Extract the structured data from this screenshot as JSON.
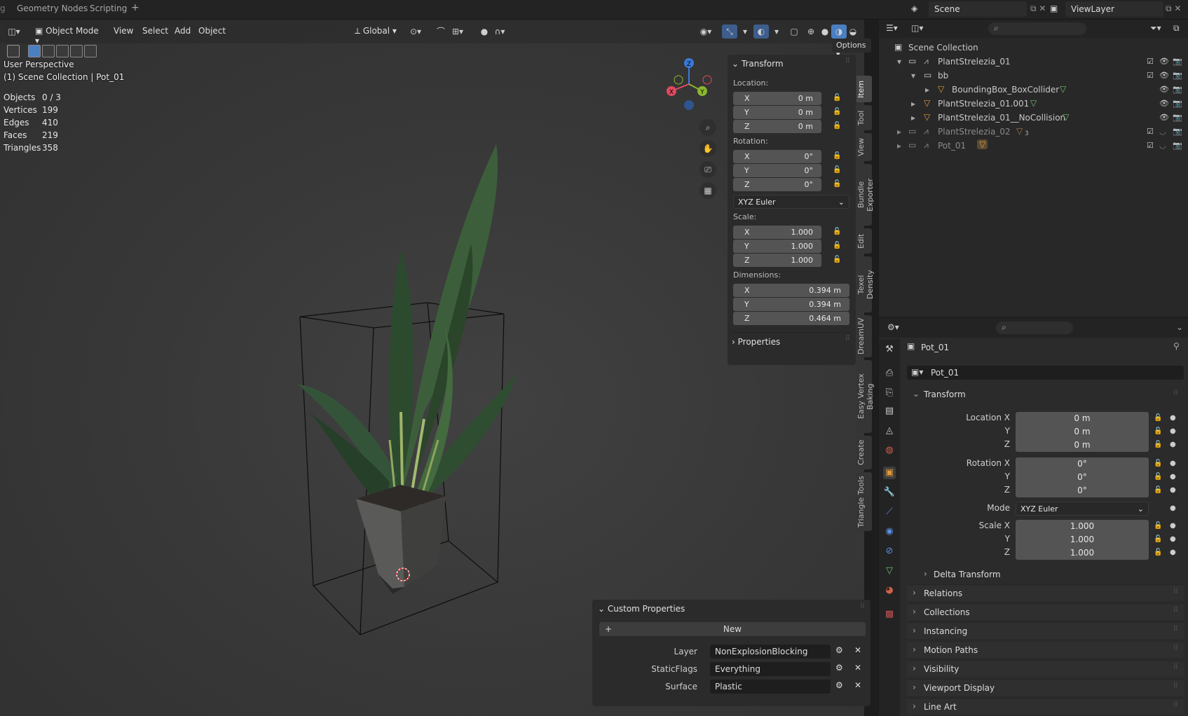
{
  "topbar": {
    "workspace_tabs": [
      "Geometry Nodes",
      "Scripting"
    ],
    "add_tab": "+",
    "scene": "Scene",
    "view_layer": "ViewLayer"
  },
  "viewport_header": {
    "mode": "Object Mode",
    "menus": [
      "View",
      "Select",
      "Add",
      "Object"
    ],
    "orientation": "Global",
    "options": "Options"
  },
  "overlay": {
    "view_name": "User Perspective",
    "collection_path": "(1) Scene Collection | Pot_01",
    "stats": [
      {
        "label": "Objects",
        "value": "0 / 3"
      },
      {
        "label": "Vertices",
        "value": "199"
      },
      {
        "label": "Edges",
        "value": "410"
      },
      {
        "label": "Faces",
        "value": "219"
      },
      {
        "label": "Triangles",
        "value": "358"
      }
    ]
  },
  "gizmo": {
    "x": "X",
    "y": "Y",
    "z": "Z"
  },
  "npanel": {
    "title": "Transform",
    "location_label": "Location:",
    "location": [
      {
        "axis": "X",
        "value": "0 m"
      },
      {
        "axis": "Y",
        "value": "0 m"
      },
      {
        "axis": "Z",
        "value": "0 m"
      }
    ],
    "rotation_label": "Rotation:",
    "rotation": [
      {
        "axis": "X",
        "value": "0°"
      },
      {
        "axis": "Y",
        "value": "0°"
      },
      {
        "axis": "Z",
        "value": "0°"
      }
    ],
    "rotation_mode": "XYZ Euler",
    "scale_label": "Scale:",
    "scale": [
      {
        "axis": "X",
        "value": "1.000"
      },
      {
        "axis": "Y",
        "value": "1.000"
      },
      {
        "axis": "Z",
        "value": "1.000"
      }
    ],
    "dimensions_label": "Dimensions:",
    "dimensions": [
      {
        "axis": "X",
        "value": "0.394 m"
      },
      {
        "axis": "Y",
        "value": "0.394 m"
      },
      {
        "axis": "Z",
        "value": "0.464 m"
      }
    ],
    "properties": "Properties"
  },
  "vertical_tabs": [
    "Item",
    "Tool",
    "View",
    "Bundle Exporter",
    "Edit",
    "Texel Density",
    "DreamUV",
    "Easy Vertex Baking",
    "Create",
    "Triangle Tools"
  ],
  "custom_properties": {
    "title": "Custom Properties",
    "new_label": "New",
    "items": [
      {
        "label": "Layer",
        "value": "NonExplosionBlocking"
      },
      {
        "label": "StaticFlags",
        "value": "Everything"
      },
      {
        "label": "Surface",
        "value": "Plastic"
      }
    ]
  },
  "outliner": {
    "root": "Scene Collection",
    "rows": [
      {
        "name": "PlantStrelezia_01"
      },
      {
        "name": "bb"
      },
      {
        "name": "BoundingBox_BoxCollider"
      },
      {
        "name": "PlantStrelezia_01.001"
      },
      {
        "name": "PlantStrelezia_01__NoCollision"
      },
      {
        "name": "PlantStrelezia_02",
        "badge": "3"
      },
      {
        "name": "Pot_01"
      }
    ]
  },
  "properties": {
    "object_name": "Pot_01",
    "datablock": "Pot_01",
    "transform_title": "Transform",
    "location_label": "Location X",
    "location": [
      "0 m",
      "0 m",
      "0 m"
    ],
    "rotation_label": "Rotation X",
    "rotation": [
      "0°",
      "0°",
      "0°"
    ],
    "mode_label": "Mode",
    "mode_value": "XYZ Euler",
    "scale_label": "Scale X",
    "scale": [
      "1.000",
      "1.000",
      "1.000"
    ],
    "axis_y": "Y",
    "axis_z": "Z",
    "delta_transform": "Delta Transform",
    "sections": [
      "Relations",
      "Collections",
      "Instancing",
      "Motion Paths",
      "Visibility",
      "Viewport Display",
      "Line Art"
    ]
  },
  "colors": {
    "axis_x": "#e04a5f",
    "axis_y": "#8ab62e",
    "axis_z": "#3a79d8",
    "accent": "#4a7fc1"
  }
}
